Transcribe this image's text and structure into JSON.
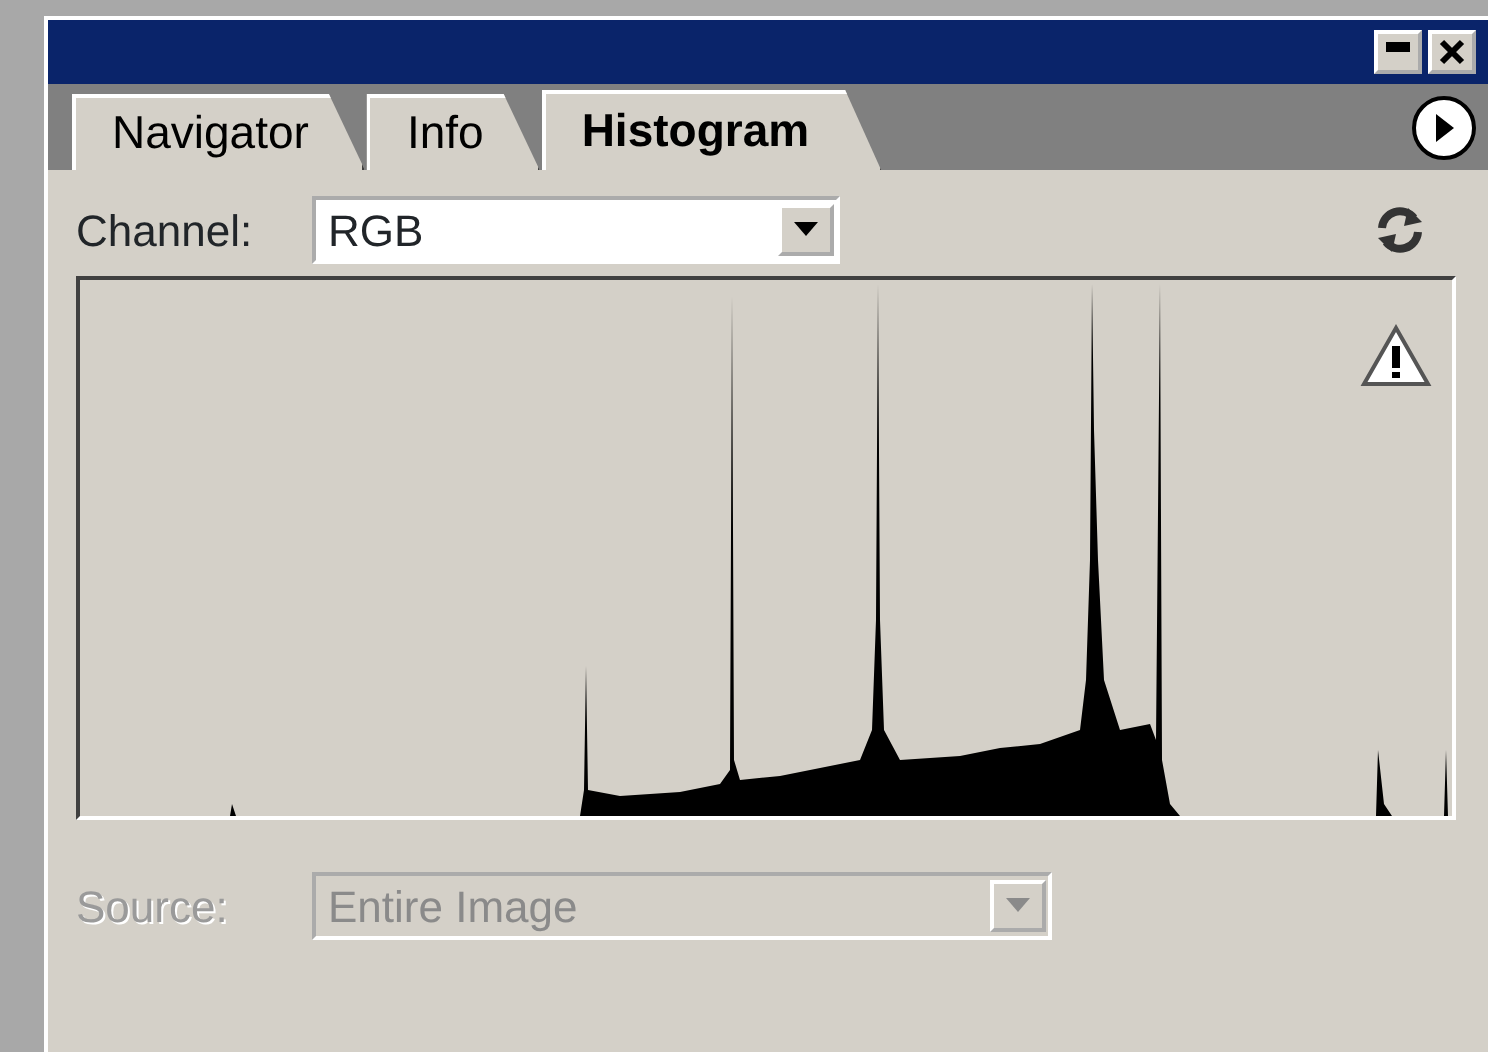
{
  "tabs": [
    {
      "label": "Navigator",
      "selected": false
    },
    {
      "label": "Info",
      "selected": false
    },
    {
      "label": "Histogram",
      "selected": true
    }
  ],
  "channel": {
    "label": "Channel:",
    "value": "RGB",
    "disabled": false
  },
  "source": {
    "label": "Source:",
    "value": "Entire Image",
    "disabled": true
  }
}
